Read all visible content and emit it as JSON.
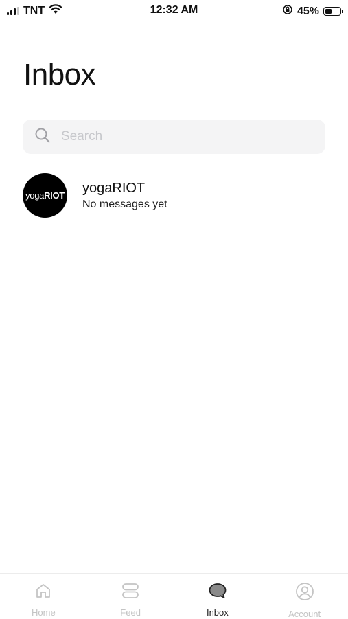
{
  "status_bar": {
    "carrier": "TNT",
    "time": "12:32 AM",
    "battery_percent": "45%",
    "battery_level": 0.45,
    "icons": [
      "signal-icon",
      "wifi-icon",
      "orientation-lock-icon",
      "battery-icon"
    ]
  },
  "header": {
    "title": "Inbox"
  },
  "search": {
    "placeholder": "Search",
    "value": ""
  },
  "conversations": [
    {
      "name": "yogaRIOT",
      "preview": "No messages yet",
      "avatar_text_light": "yoga",
      "avatar_text_bold": "RIOT"
    }
  ],
  "tab_bar": {
    "tabs": [
      {
        "label": "Home",
        "icon": "home-icon",
        "active": false
      },
      {
        "label": "Feed",
        "icon": "feed-icon",
        "active": false
      },
      {
        "label": "Inbox",
        "icon": "chat-bubble-icon",
        "active": true
      },
      {
        "label": "Account",
        "icon": "account-icon",
        "active": false
      }
    ]
  },
  "colors": {
    "text": "#111111",
    "inactive_tab": "#c4c4c4",
    "search_bg": "#f4f4f5",
    "avatar_bg": "#000000"
  }
}
